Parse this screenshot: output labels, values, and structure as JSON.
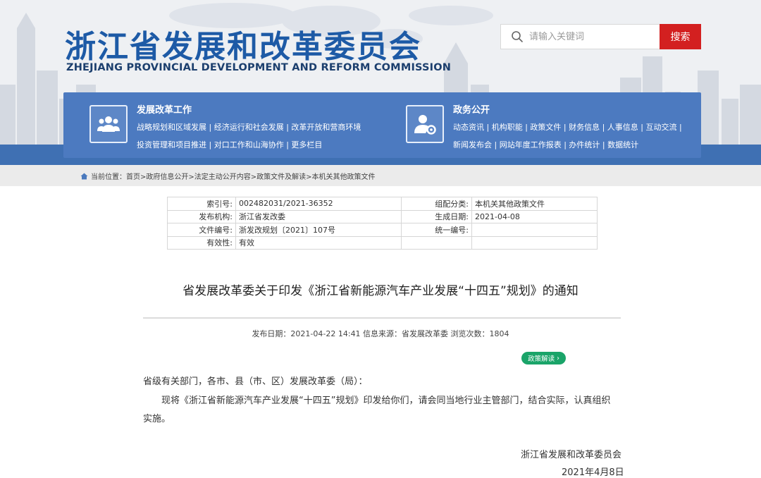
{
  "header": {
    "title_cn": "浙江省发展和改革委员会",
    "title_en": "ZHEJIANG PROVINCIAL DEVELOPMENT AND REFORM COMMISSION",
    "search_placeholder": "请输入关键词",
    "search_button": "搜索",
    "brand_color": "#1d5aa6",
    "accent_color": "#d32020"
  },
  "nav": {
    "left": {
      "icon": "people-icon",
      "title": "发展改革工作",
      "line1": "战略规划和区域发展 | 经济运行和社会发展 | 改革开放和营商环境",
      "line2": "投资管理和项目推进 | 对口工作和山海协作 | 更多栏目"
    },
    "right": {
      "icon": "user-settings-icon",
      "title": "政务公开",
      "line1": "动态资讯 | 机构职能 | 政策文件 | 财务信息 | 人事信息 | 互动交流 |",
      "line2": "新闻发布会 | 网站年度工作报表 | 办件统计 | 数据统计"
    }
  },
  "breadcrumb": {
    "text": "当前位置：首页>政府信息公开>法定主动公开内容>政策文件及解读>本机关其他政策文件"
  },
  "meta": {
    "index_label": "索引号:",
    "index_value": "002482031/2021-36352",
    "category_label": "组配分类:",
    "category_value": "本机关其他政策文件",
    "publisher_label": "发布机构:",
    "publisher_value": "浙江省发改委",
    "created_label": "生成日期:",
    "created_value": "2021-04-08",
    "docno_label": "文件编号:",
    "docno_value": "浙发改规划〔2021〕107号",
    "unified_label": "统一编号:",
    "unified_value": "",
    "validity_label": "有效性:",
    "validity_value": "有效"
  },
  "article": {
    "title": "省发展改革委关于印发《浙江省新能源汽车产业发展“十四五”规划》的通知",
    "info": "发布日期：2021-04-22 14:41    信息来源：省发展改革委    浏览次数：1804",
    "policy_button": "政策解读",
    "salutation": "省级有关部门，各市、县（市、区）发展改革委（局）：",
    "para1_line1": "现将《浙江省新能源汽车产业发展“十四五”规划》印发给你们，请会同当地行业主管部门，结合实际，认真组织",
    "para1_line2": "实施。",
    "signature": "浙江省发展和改革委员会",
    "date": "2021年4月8日"
  }
}
